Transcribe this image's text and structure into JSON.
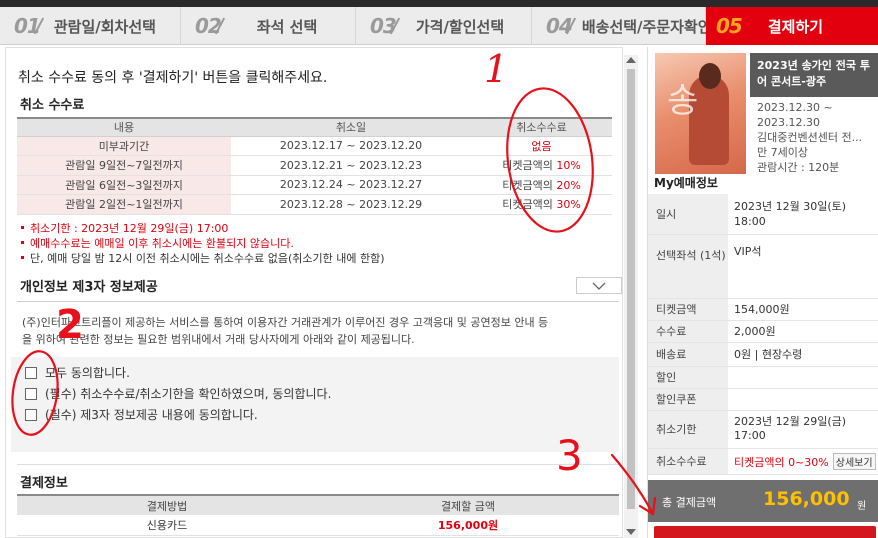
{
  "steps": [
    {
      "num": "01",
      "label": "관람일/회차선택"
    },
    {
      "num": "02",
      "label": "좌석 선택"
    },
    {
      "num": "03",
      "label": "가격/할인선택"
    },
    {
      "num": "04",
      "label": "배송선택/주문자확인"
    },
    {
      "num": "05",
      "label": "결제하기"
    }
  ],
  "instruction": "취소 수수료 동의 후 '결제하기' 버튼을 클릭해주세요.",
  "cancel_fee": {
    "title": "취소 수수료",
    "headers": [
      "내용",
      "취소일",
      "취소수수료"
    ],
    "rows": [
      {
        "content": "미부과기간",
        "date": "2023.12.17 ~ 2023.12.20",
        "fee": "없음"
      },
      {
        "content": "관람일 9일전~7일전까지",
        "date": "2023.12.21 ~ 2023.12.23",
        "fee_prefix": "티켓금액의 ",
        "fee_pct": "10%"
      },
      {
        "content": "관람일 6일전~3일전까지",
        "date": "2023.12.24 ~ 2023.12.27",
        "fee_prefix": "티켓금액의 ",
        "fee_pct": "20%"
      },
      {
        "content": "관람일 2일전~1일전까지",
        "date": "2023.12.28 ~ 2023.12.29",
        "fee_prefix": "티켓금액의 ",
        "fee_pct": "30%"
      }
    ],
    "notes": [
      "취소기한 : 2023년 12월 29일(금) 17:00",
      "예매수수료는 예매일 이후 취소시에는 환불되지 않습니다.",
      "단, 예매 당일 밤 12시 이전 취소시에는 취소수수료 없음(취소기한 내에 한함)"
    ]
  },
  "privacy": {
    "title": "개인정보 제3자 정보제공",
    "text_line1": "(주)인터파크트리플이 제공하는 서비스를 통하여 이용자간 거래관계가 이루어진 경우 고객응대 및 공연정보 안내 등",
    "text_line2": "을 위하여 관련한 정보는 필요한 범위내에서 거래 당사자에게 아래와 같이 제공됩니다."
  },
  "agreements": [
    "모두 동의합니다.",
    "(필수) 취소수수료/취소기한을 확인하였으며, 동의합니다.",
    "(필수) 제3자 정보제공 내용에 동의합니다."
  ],
  "payment": {
    "title": "결제정보",
    "headers": [
      "결제방법",
      "결제할 금액"
    ],
    "method": "신용카드",
    "amount": "156,000원"
  },
  "show": {
    "title": "2023년 송가인 전국 투어 콘서트-광주",
    "period_start": "2023.12.30 ~",
    "period_end": "2023.12.30",
    "venue": "김대중컨벤션센터 전...",
    "age": "만 7세이상",
    "runtime": "관람시간 : 120분",
    "poster_glyph": "송"
  },
  "my_booking": {
    "title": "My예매정보",
    "date_label": "일시",
    "date_value": "2023년 12월 30일(토) 18:00",
    "seat_label": "선택좌석 (1석)",
    "seat_value": "VIP석",
    "ticket_label": "티켓금액",
    "ticket_value": "154,000원",
    "fee_label": "수수료",
    "fee_value": "2,000원",
    "delivery_label": "배송료",
    "delivery_value": "0원 | 현장수령",
    "discount_label": "할인",
    "coupon_label": "할인쿠폰",
    "deadline_label": "취소기한",
    "deadline_value": "2023년 12월 29일(금) 17:00",
    "cancelfee_label": "취소수수료",
    "cancelfee_value": "티켓금액의 0~30%",
    "detail_button": "상세보기"
  },
  "total": {
    "label": "총 결제금액",
    "amount": "156,000",
    "unit": "원"
  },
  "annotations": [
    "1",
    "2",
    "3"
  ],
  "colors": {
    "accent": "#e2000f",
    "total_amount": "#ffc000",
    "annotation": "#e8101a"
  }
}
